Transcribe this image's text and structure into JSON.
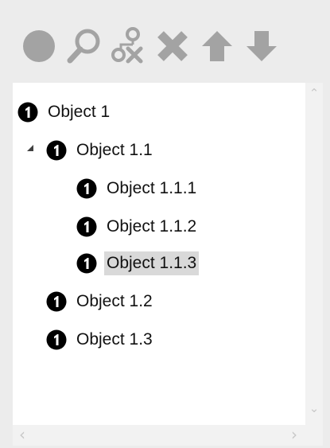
{
  "toolbar": {
    "buttons": [
      {
        "name": "add-object-button",
        "icon": "circle-icon"
      },
      {
        "name": "find-button",
        "icon": "magnifier-icon"
      },
      {
        "name": "remove-relation-button",
        "icon": "node-remove-icon"
      },
      {
        "name": "delete-button",
        "icon": "close-x-icon"
      },
      {
        "name": "move-up-button",
        "icon": "arrow-up-icon"
      },
      {
        "name": "move-down-button",
        "icon": "arrow-down-icon"
      }
    ],
    "icon_color": "#a3a3a3"
  },
  "tree": {
    "nodes": [
      {
        "label": "Object 1",
        "depth": 0,
        "expanded": null
      },
      {
        "label": "Object 1.1",
        "depth": 1,
        "expanded": true
      },
      {
        "label": "Object 1.1.1",
        "depth": 2,
        "expanded": null
      },
      {
        "label": "Object 1.1.2",
        "depth": 2,
        "expanded": null
      },
      {
        "label": "Object 1.1.3",
        "depth": 2,
        "expanded": null,
        "selected": true
      },
      {
        "label": "Object 1.2",
        "depth": 1,
        "expanded": null
      },
      {
        "label": "Object 1.3",
        "depth": 1,
        "expanded": null
      }
    ],
    "node_icon": "info-circle-icon",
    "selection_color": "#d9d9d9"
  },
  "scrollbars": {
    "up": "⌃",
    "down": "⌄",
    "left": "‹",
    "right": "›"
  }
}
